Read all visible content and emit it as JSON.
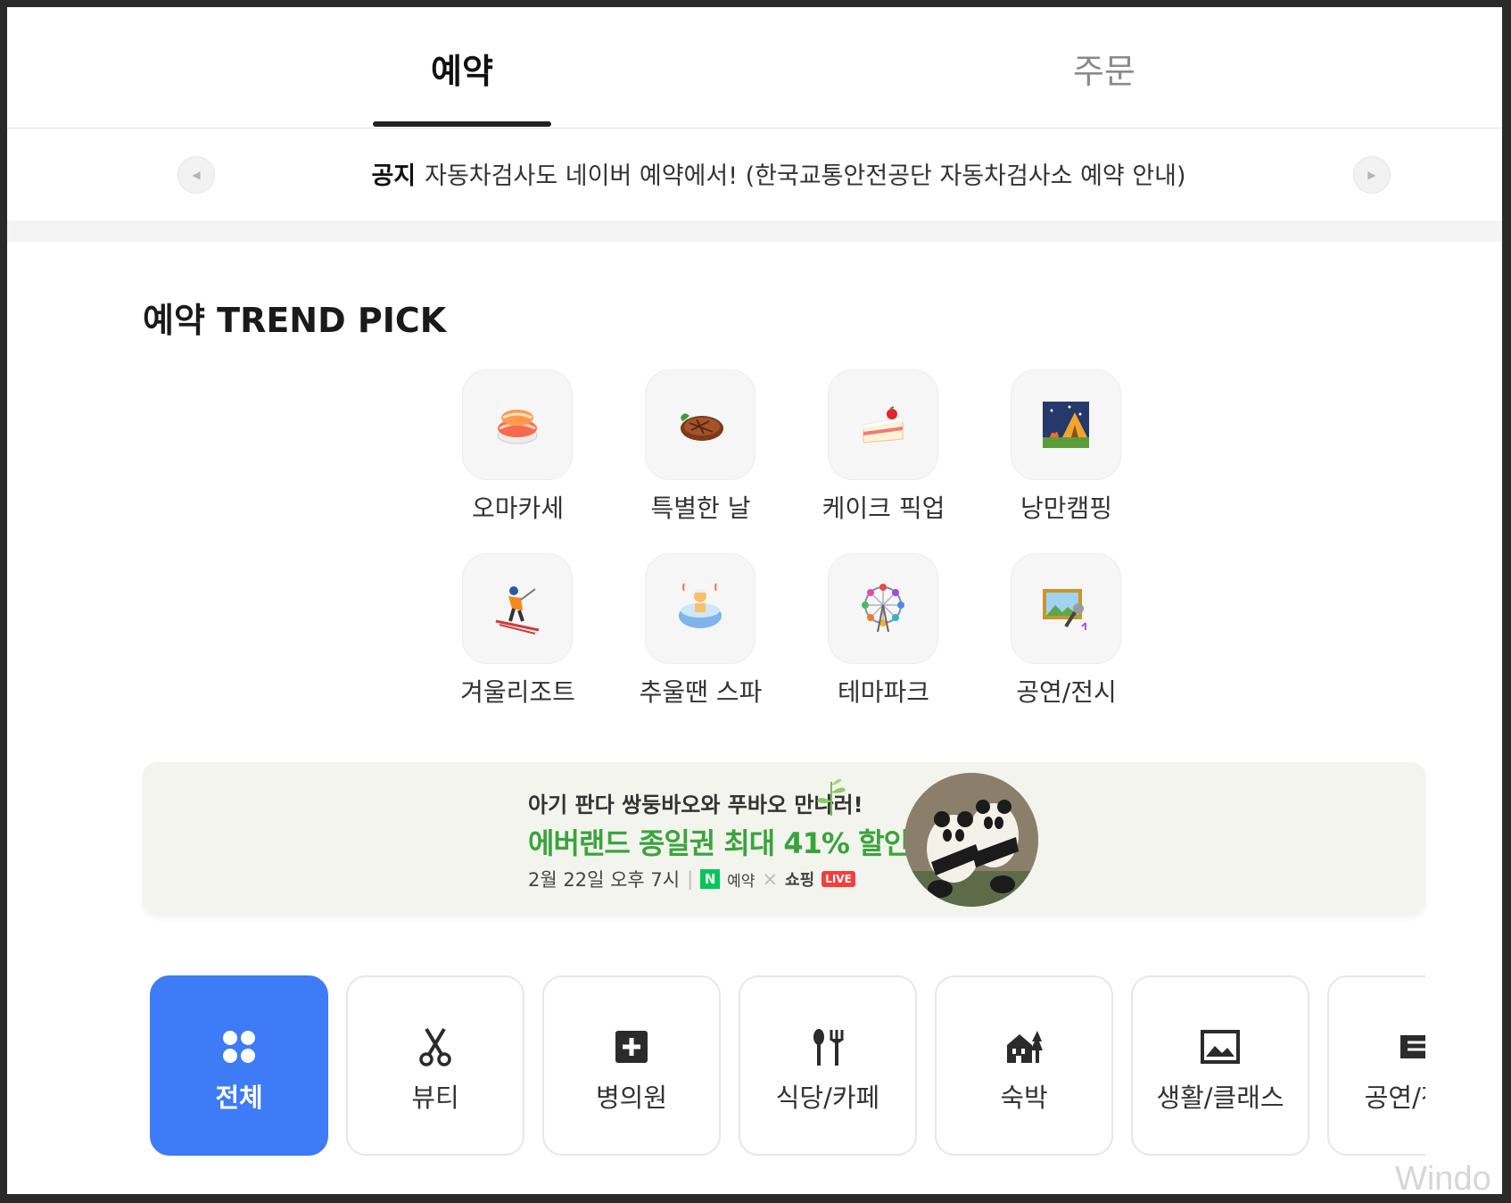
{
  "tabs": {
    "reserve": "예약",
    "order": "주문"
  },
  "notice": {
    "tag": "공지",
    "text": "자동차검사도 네이버 예약에서! (한국교통안전공단 자동차검사소 예약 안내)"
  },
  "trend": {
    "title": "예약 TREND PICK",
    "items": [
      {
        "label": "오마카세",
        "icon": "sushi-icon"
      },
      {
        "label": "특별한 날",
        "icon": "steak-icon"
      },
      {
        "label": "케이크 픽업",
        "icon": "cake-icon"
      },
      {
        "label": "낭만캠핑",
        "icon": "camping-icon"
      },
      {
        "label": "겨울리조트",
        "icon": "skier-icon"
      },
      {
        "label": "추울땐 스파",
        "icon": "spa-icon"
      },
      {
        "label": "테마파크",
        "icon": "ferris-wheel-icon"
      },
      {
        "label": "공연/전시",
        "icon": "exhibition-icon"
      }
    ]
  },
  "banner": {
    "line1": "아기 판다 쌍둥바오와 푸바오 만나러!",
    "line2": "에버랜드 종일권 최대 41% 할인!",
    "date": "2월 22일 오후 7시",
    "n_badge": "N",
    "reserve": "예약",
    "times": "×",
    "shopping": "쇼핑",
    "live": "LIVE"
  },
  "categories": [
    {
      "label": "전체",
      "icon": "grid-icon",
      "active": true
    },
    {
      "label": "뷰티",
      "icon": "scissors-icon"
    },
    {
      "label": "병의원",
      "icon": "medical-cross-icon"
    },
    {
      "label": "식당/카페",
      "icon": "fork-knife-icon"
    },
    {
      "label": "숙박",
      "icon": "lodging-icon"
    },
    {
      "label": "생활/클래스",
      "icon": "picture-frame-icon"
    },
    {
      "label": "공연/전시",
      "icon": "ticket-icon"
    }
  ],
  "colors": {
    "accent": "#3e7bf6",
    "banner_green": "#3aa43c"
  },
  "watermark": "Windo"
}
